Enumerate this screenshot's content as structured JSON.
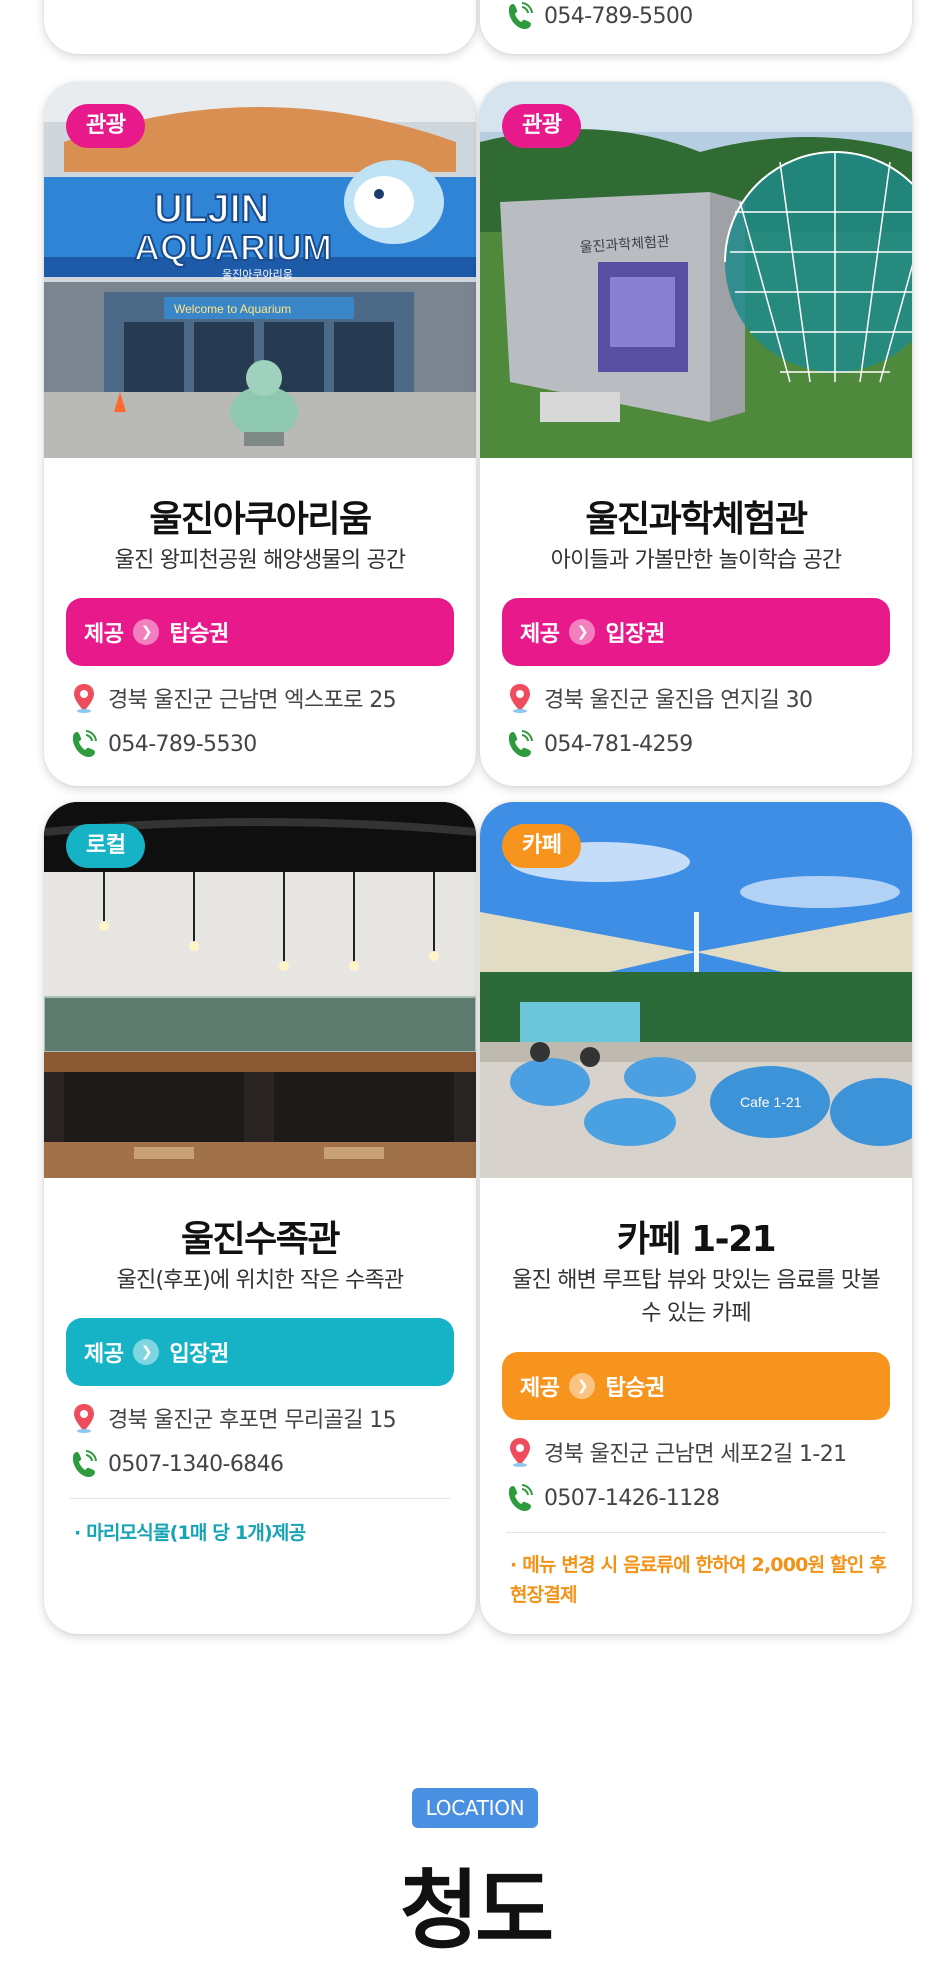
{
  "top_cards": [
    {
      "phone": ""
    },
    {
      "phone": "054-789-5500"
    }
  ],
  "cards": [
    {
      "category": "관광",
      "category_color": "#e8198b",
      "name": "울진아쿠아리움",
      "description": "울진 왕피천공원 해양생물의 공간",
      "offer_label": "제공",
      "offer_value": "탑승권",
      "offer_color": "#e8198b",
      "address": "경북 울진군 근남면 엑스포로 25",
      "phone": "054-789-5530",
      "note": "",
      "photo_text": [
        "ULJIN",
        "AQUARIUM",
        "울진아쿠아리움",
        "Welcome to Aquarium"
      ]
    },
    {
      "category": "관광",
      "category_color": "#e8198b",
      "name": "울진과학체험관",
      "description": "아이들과 가볼만한 놀이학습 공간",
      "offer_label": "제공",
      "offer_value": "입장권",
      "offer_color": "#e8198b",
      "address": "경북 울진군 울진읍 연지길 30",
      "phone": "054-781-4259",
      "note": "",
      "photo_text": [
        "울진과학체험관"
      ]
    },
    {
      "category": "로컬",
      "category_color": "#16b3c6",
      "name": "울진수족관",
      "description": "울진(후포)에 위치한 작은 수족관",
      "offer_label": "제공",
      "offer_value": "입장권",
      "offer_color": "#16b3c6",
      "address": "경북 울진군 후포면 무리골길 15",
      "phone": "0507-1340-6846",
      "note": "· 마리모식물(1매 당 1개)제공",
      "note_color": "#16a3b6"
    },
    {
      "category": "카페",
      "category_color": "#f7941d",
      "name": "카페 1-21",
      "description": "울진 해변 루프탑 뷰와 맛있는 음료를 맛볼 수 있는 카페",
      "offer_label": "제공",
      "offer_value": "탑승권",
      "offer_color": "#f7941d",
      "address": "경북 울진군 근남면 세포2길 1-21",
      "phone": "0507-1426-1128",
      "note": "· 메뉴 변경 시 음료류에 한하여 2,000원 할인 후 현장결제",
      "note_color": "#f29318",
      "photo_text": [
        "Cafe 1-21"
      ]
    }
  ],
  "location": {
    "tag": "LOCATION",
    "title": "청도"
  }
}
